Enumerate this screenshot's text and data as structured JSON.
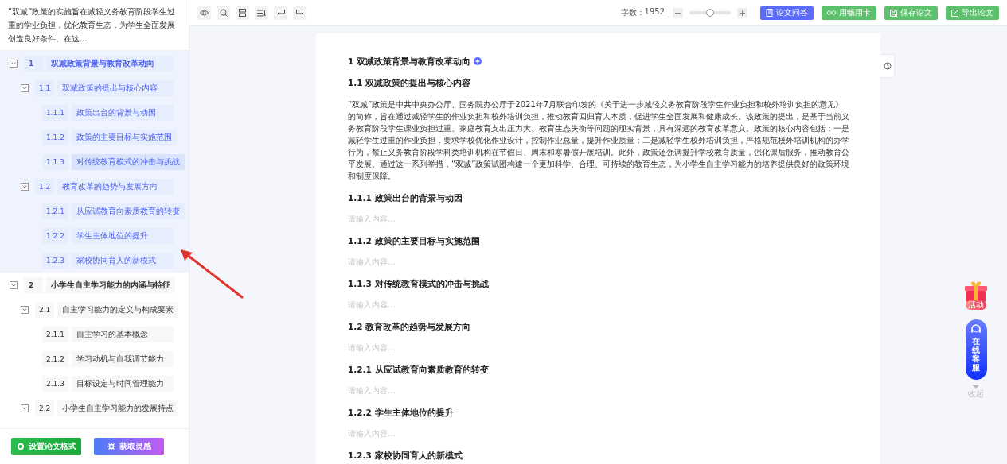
{
  "sidebar": {
    "summary": "“双减”政策的实施旨在减轻义务教育阶段学生过重的学业负担，优化教育生态，为学生全面发展创造良好条件。在这...",
    "outline": [
      {
        "number": "1",
        "title": "双减政策背景与教育改革动向",
        "selected": true,
        "expanded": true,
        "hovered": false,
        "children": [
          {
            "number": "1.1",
            "title": "双减政策的提出与核心内容",
            "expanded": true,
            "hovered": false,
            "children": [
              {
                "number": "1.1.1",
                "title": "政策出台的背景与动因",
                "hovered": false
              },
              {
                "number": "1.1.2",
                "title": "政策的主要目标与实施范围",
                "hovered": false
              },
              {
                "number": "1.1.3",
                "title": "对传统教育模式的冲击与挑战",
                "hovered": true
              }
            ]
          },
          {
            "number": "1.2",
            "title": "教育改革的趋势与发展方向",
            "expanded": true,
            "hovered": false,
            "children": [
              {
                "number": "1.2.1",
                "title": "从应试教育向素质教育的转变",
                "hovered": false
              },
              {
                "number": "1.2.2",
                "title": "学生主体地位的提升",
                "hovered": false
              },
              {
                "number": "1.2.3",
                "title": "家校协同育人的新模式",
                "hovered": false
              }
            ]
          }
        ]
      },
      {
        "number": "2",
        "title": "小学生自主学习能力的内涵与特征",
        "selected": false,
        "expanded": true,
        "hovered": false,
        "children": [
          {
            "number": "2.1",
            "title": "自主学习能力的定义与构成要素",
            "expanded": true,
            "hovered": false,
            "children": [
              {
                "number": "2.1.1",
                "title": "自主学习的基本概念",
                "hovered": false
              },
              {
                "number": "2.1.2",
                "title": "学习动机与自我调节能力",
                "hovered": false
              },
              {
                "number": "2.1.3",
                "title": "目标设定与时间管理能力",
                "hovered": false
              }
            ]
          },
          {
            "number": "2.2",
            "title": "小学生自主学习能力的发展特点",
            "expanded": true,
            "hovered": false
          }
        ]
      }
    ],
    "buttons": [
      {
        "label": "设置论文格式",
        "kind": "format"
      },
      {
        "label": "获取灵感",
        "kind": "inspire"
      }
    ]
  },
  "toolbar": {
    "tools": [
      {
        "kind": "preview"
      },
      {
        "kind": "search"
      },
      {
        "kind": "layout"
      },
      {
        "kind": "sort"
      },
      {
        "kind": "undo"
      },
      {
        "kind": "redo"
      }
    ],
    "word_count_label": "字数：",
    "word_count": "1952",
    "zoom": {
      "level": 0.5
    },
    "buttons": [
      {
        "label": "论文问答",
        "kind": "qa"
      },
      {
        "label": "用畅用卡",
        "kind": "card"
      },
      {
        "label": "保存论文",
        "kind": "save"
      },
      {
        "label": "导出论文",
        "kind": "export"
      }
    ]
  },
  "document": {
    "blocks": [
      {
        "kind": "heading_add",
        "text": "1 双减政策背景与教育改革动向"
      },
      {
        "kind": "heading",
        "text": "1.1 双减政策的提出与核心内容"
      },
      {
        "kind": "paragraph",
        "text": "“双减”政策是中共中央办公厅、国务院办公厅于2021年7月联合印发的《关于进一步减轻义务教育阶段学生作业负担和校外培训负担的意见》的简称，旨在通过减轻学生的作业负担和校外培训负担，推动教育回归育人本质，促进学生全面发展和健康成长。该政策的提出，是基于当前义务教育阶段学生课业负担过重、家庭教育支出压力大、教育生态失衡等问题的现实背景，具有深远的教育改革意义。政策的核心内容包括：一是减轻学生过重的作业负担，要求学校优化作业设计，控制作业总量，提升作业质量；二是减轻学生校外培训负担，严格规范校外培训机构的办学行为，禁止义务教育阶段学科类培训机构在节假日、周末和寒暑假开展培训。此外，政策还强调提升学校教育质量，强化课后服务，推动教育公平发展。通过这一系列举措，“双减”政策试图构建一个更加科学、合理、可持续的教育生态，为小学生自主学习能力的培养提供良好的政策环境和制度保障。"
      },
      {
        "kind": "heading",
        "text": "1.1.1 政策出台的背景与动因"
      },
      {
        "kind": "placeholder",
        "text": "请输入内容..."
      },
      {
        "kind": "heading",
        "text": "1.1.2 政策的主要目标与实施范围"
      },
      {
        "kind": "placeholder",
        "text": "请输入内容..."
      },
      {
        "kind": "heading",
        "text": "1.1.3 对传统教育模式的冲击与挑战"
      },
      {
        "kind": "placeholder",
        "text": "请输入内容..."
      },
      {
        "kind": "heading",
        "text": "1.2 教育改革的趋势与发展方向"
      },
      {
        "kind": "placeholder",
        "text": "请输入内容..."
      },
      {
        "kind": "heading",
        "text": "1.2.1 从应试教育向素质教育的转变"
      },
      {
        "kind": "placeholder",
        "text": "请输入内容..."
      },
      {
        "kind": "heading",
        "text": "1.2.2 学生主体地位的提升"
      },
      {
        "kind": "placeholder",
        "text": "请输入内容..."
      },
      {
        "kind": "heading",
        "text": "1.2.3 家校协同育人的新模式"
      }
    ]
  },
  "floating": {
    "activity_label": "活动",
    "service_label": "在线客服",
    "collapse_label": "收起"
  }
}
